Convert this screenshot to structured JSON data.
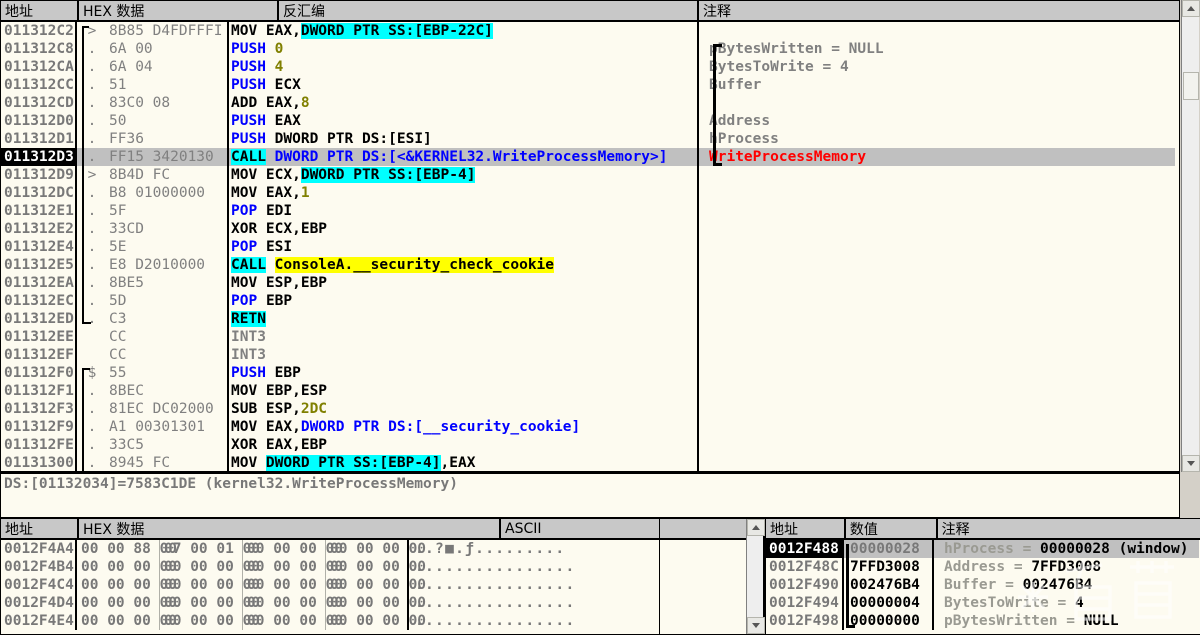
{
  "disasm": {
    "headers": {
      "address": "地址",
      "hex": "HEX 数据",
      "disassembly": "反汇编",
      "comment": "注释"
    },
    "rows": [
      {
        "addr": "011312C2",
        "mark": ">",
        "hex": "8B85 D4FDFFFI",
        "dis_pre": "MOV EAX,",
        "dis_hl": "DWORD PTR SS:[EBP-22C]",
        "dis_post": "",
        "hl": "cyan",
        "cmt": ""
      },
      {
        "addr": "011312C8",
        "mark": ".",
        "hex": "6A 00",
        "dis_pre": "PUSH ",
        "dis_hl": "",
        "dis_post": "0",
        "hl": "none",
        "cmt": "pBytesWritten = NULL"
      },
      {
        "addr": "011312CA",
        "mark": ".",
        "hex": "6A 04",
        "dis_pre": "PUSH ",
        "dis_hl": "",
        "dis_post": "4",
        "hl": "none",
        "cmt": "BytesToWrite = 4"
      },
      {
        "addr": "011312CC",
        "mark": ".",
        "hex": "51",
        "dis_pre": "PUSH ",
        "dis_hl": "",
        "dis_post": "ECX",
        "hl": "none",
        "cmt": "Buffer"
      },
      {
        "addr": "011312CD",
        "mark": ".",
        "hex": "83C0 08",
        "dis_pre": "ADD EAX,",
        "dis_hl": "",
        "dis_post": "8",
        "hl": "none",
        "cmt": ""
      },
      {
        "addr": "011312D0",
        "mark": ".",
        "hex": "50",
        "dis_pre": "PUSH ",
        "dis_hl": "",
        "dis_post": "EAX",
        "hl": "none",
        "cmt": "Address"
      },
      {
        "addr": "011312D1",
        "mark": ".",
        "hex": "FF36",
        "dis_pre": "PUSH ",
        "dis_hl": "",
        "dis_post": "DWORD PTR DS:[ESI]",
        "hl": "none",
        "cmt": "hProcess"
      },
      {
        "addr": "011312D3",
        "mark": ".",
        "hex": "FF15 3420130",
        "dis_pre": "CALL",
        "dis_hl": "",
        "dis_post": " DWORD PTR DS:[<&KERNEL32.WriteProcessMemory>]",
        "hl": "call-cyan",
        "cmt": "WriteProcessMemory"
      },
      {
        "addr": "011312D9",
        "mark": ">",
        "hex": "8B4D FC",
        "dis_pre": "MOV ECX,",
        "dis_hl": "DWORD PTR SS:[EBP-4]",
        "dis_post": "",
        "hl": "cyan",
        "cmt": ""
      },
      {
        "addr": "011312DC",
        "mark": ".",
        "hex": "B8 01000000",
        "dis_pre": "MOV EAX,",
        "dis_hl": "",
        "dis_post": "1",
        "hl": "none",
        "cmt": ""
      },
      {
        "addr": "011312E1",
        "mark": ".",
        "hex": "5F",
        "dis_pre": "POP ",
        "dis_hl": "",
        "dis_post": "EDI",
        "hl": "none",
        "cmt": ""
      },
      {
        "addr": "011312E2",
        "mark": ".",
        "hex": "33CD",
        "dis_pre": "XOR ECX,EBP",
        "dis_hl": "",
        "dis_post": "",
        "hl": "none",
        "cmt": ""
      },
      {
        "addr": "011312E4",
        "mark": ".",
        "hex": "5E",
        "dis_pre": "POP ",
        "dis_hl": "",
        "dis_post": "ESI",
        "hl": "none",
        "cmt": ""
      },
      {
        "addr": "011312E5",
        "mark": ".",
        "hex": "E8 D2010000",
        "dis_pre": "CALL",
        "dis_hl": "ConsoleA.__security_check_cookie",
        "dis_post": "",
        "hl": "call-yellow",
        "cmt": ""
      },
      {
        "addr": "011312EA",
        "mark": ".",
        "hex": "8BE5",
        "dis_pre": "MOV ESP,EBP",
        "dis_hl": "",
        "dis_post": "",
        "hl": "none",
        "cmt": ""
      },
      {
        "addr": "011312EC",
        "mark": ".",
        "hex": "5D",
        "dis_pre": "POP ",
        "dis_hl": "",
        "dis_post": "EBP",
        "hl": "none",
        "cmt": ""
      },
      {
        "addr": "011312ED",
        "mark": ".",
        "hex": "C3",
        "dis_pre": "RETN",
        "dis_hl": "",
        "dis_post": "",
        "hl": "retn-cyan",
        "cmt": ""
      },
      {
        "addr": "011312EE",
        "mark": "",
        "hex": "CC",
        "dis_pre": "INT3",
        "dis_hl": "",
        "dis_post": "",
        "hl": "dim",
        "cmt": ""
      },
      {
        "addr": "011312EF",
        "mark": "",
        "hex": "CC",
        "dis_pre": "INT3",
        "dis_hl": "",
        "dis_post": "",
        "hl": "dim",
        "cmt": ""
      },
      {
        "addr": "011312F0",
        "mark": "$",
        "hex": "55",
        "dis_pre": "PUSH ",
        "dis_hl": "",
        "dis_post": "EBP",
        "hl": "none",
        "cmt": ""
      },
      {
        "addr": "011312F1",
        "mark": ".",
        "hex": "8BEC",
        "dis_pre": "MOV EBP,ESP",
        "dis_hl": "",
        "dis_post": "",
        "hl": "none",
        "cmt": ""
      },
      {
        "addr": "011312F3",
        "mark": ".",
        "hex": "81EC DC02000",
        "dis_pre": "SUB ESP,",
        "dis_hl": "",
        "dis_post": "2DC",
        "hl": "none",
        "cmt": ""
      },
      {
        "addr": "011312F9",
        "mark": ".",
        "hex": "A1 00301301",
        "dis_pre": "MOV EAX,",
        "dis_hl": "",
        "dis_post": "DWORD PTR DS:[__security_cookie]",
        "hl": "none",
        "cmt": ""
      },
      {
        "addr": "011312FE",
        "mark": ".",
        "hex": "33C5",
        "dis_pre": "XOR EAX,EBP",
        "dis_hl": "",
        "dis_post": "",
        "hl": "none",
        "cmt": ""
      },
      {
        "addr": "01131300",
        "mark": ".",
        "hex": "8945 FC",
        "dis_pre": "MOV ",
        "dis_hl": "DWORD PTR SS:[EBP-4]",
        "dis_post": ",EAX",
        "hl": "cyan",
        "cmt": ""
      }
    ],
    "selected_index": 7,
    "info_line": "DS:[01132034]=7583C1DE (kernel32.WriteProcessMemory)"
  },
  "dump": {
    "headers": {
      "address": "地址",
      "hex": "HEX 数据",
      "ascii": "ASCII"
    },
    "rows": [
      {
        "addr": "0012F4A4",
        "g1": "00 00 88 00",
        "g2": "07 00 01 00",
        "g3": "00 00 00 00",
        "g4": "00 00 00 00",
        "ascii": "..?■.ƒ........."
      },
      {
        "addr": "0012F4B4",
        "g1": "00 00 00 00",
        "g2": "00 00 00 00",
        "g3": "00 00 00 00",
        "g4": "00 00 00 00",
        "ascii": "................"
      },
      {
        "addr": "0012F4C4",
        "g1": "00 00 00 00",
        "g2": "00 00 00 00",
        "g3": "00 00 00 00",
        "g4": "00 00 00 00",
        "ascii": "................"
      },
      {
        "addr": "0012F4D4",
        "g1": "00 00 00 00",
        "g2": "00 00 00 00",
        "g3": "00 00 00 00",
        "g4": "00 00 00 00",
        "ascii": "................"
      },
      {
        "addr": "0012F4E4",
        "g1": "00 00 00 00",
        "g2": "00 00 00 00",
        "g3": "00 00 00 00",
        "g4": "00 00 00 00",
        "ascii": "................"
      }
    ]
  },
  "stack": {
    "headers": {
      "address": "地址",
      "value": "数值",
      "comment": "注释"
    },
    "rows": [
      {
        "addr": "0012F488",
        "value": "00000028",
        "cmt_label": "hProcess = ",
        "cmt_value": "00000028 (window)"
      },
      {
        "addr": "0012F48C",
        "value": "7FFD3008",
        "cmt_label": "Address = ",
        "cmt_value": "7FFD3008"
      },
      {
        "addr": "0012F490",
        "value": "002476B4",
        "cmt_label": "Buffer = ",
        "cmt_value": "002476B4"
      },
      {
        "addr": "0012F494",
        "value": "00000004",
        "cmt_label": "BytesToWrite = ",
        "cmt_value": "4"
      },
      {
        "addr": "0012F498",
        "value": "00000000",
        "cmt_label": "pBytesWritten = ",
        "cmt_value": "NULL"
      }
    ],
    "selected_index": 0
  },
  "colors": {
    "bg": "#fdfbf0",
    "header_bg": "#c8c8c8",
    "selection": "#c0c0c0",
    "highlight_cyan": "#00ffff",
    "highlight_yellow": "#ffff00",
    "keyword_blue": "#0000ff",
    "number_olive": "#808000",
    "api_red": "#ff0000",
    "dim_gray": "#808080"
  },
  "scrollbars": {
    "disasm_position": "near-top",
    "dump_position": "top"
  }
}
